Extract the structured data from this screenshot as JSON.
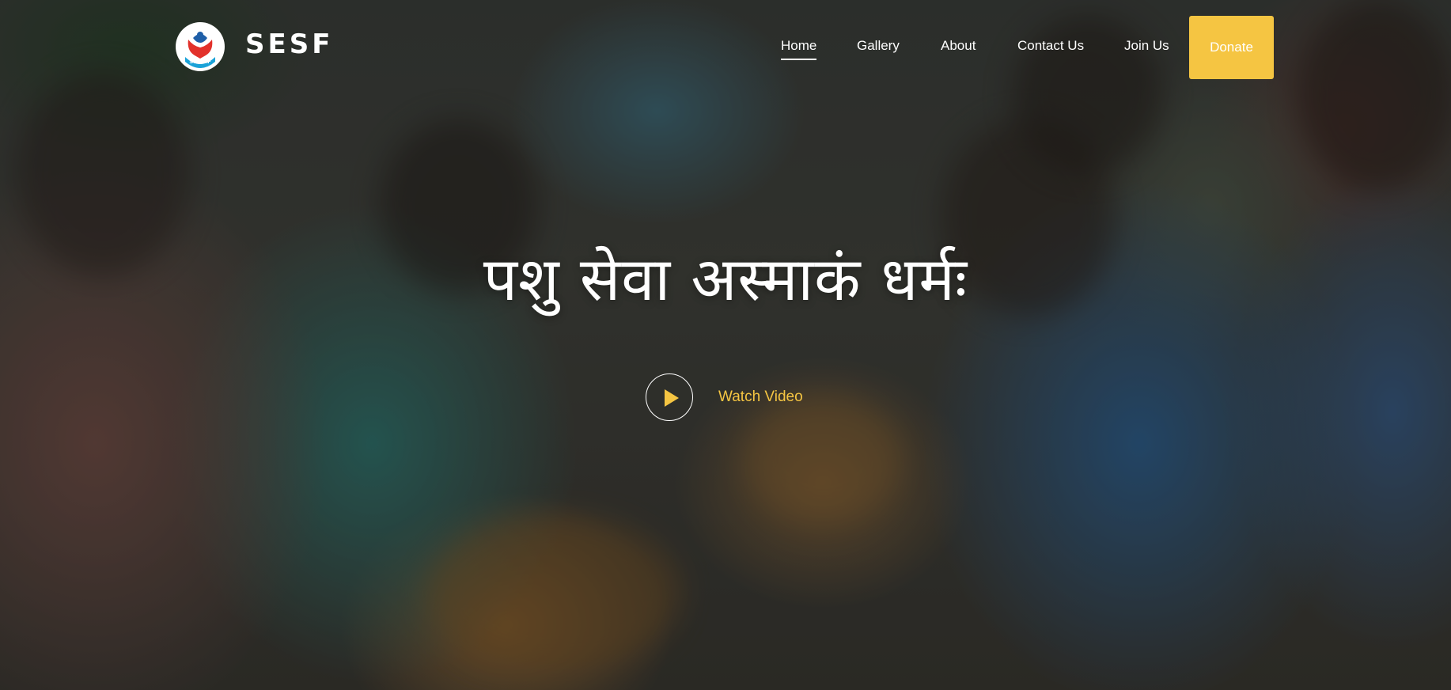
{
  "header": {
    "brand": "SESF",
    "logo_text": "S.E.S.F",
    "nav": [
      {
        "label": "Home",
        "active": true
      },
      {
        "label": "Gallery",
        "active": false
      },
      {
        "label": "About",
        "active": false
      },
      {
        "label": "Contact Us",
        "active": false
      },
      {
        "label": "Join Us",
        "active": false
      }
    ],
    "donate_label": "Donate"
  },
  "hero": {
    "tagline": "पशु सेवा अस्माकं धर्मः",
    "watch_label": "Watch Video",
    "icons": {
      "logo": "sesf-logo-icon",
      "play": "play-icon"
    }
  },
  "colors": {
    "accent": "#f5c542",
    "text": "#ffffff"
  }
}
